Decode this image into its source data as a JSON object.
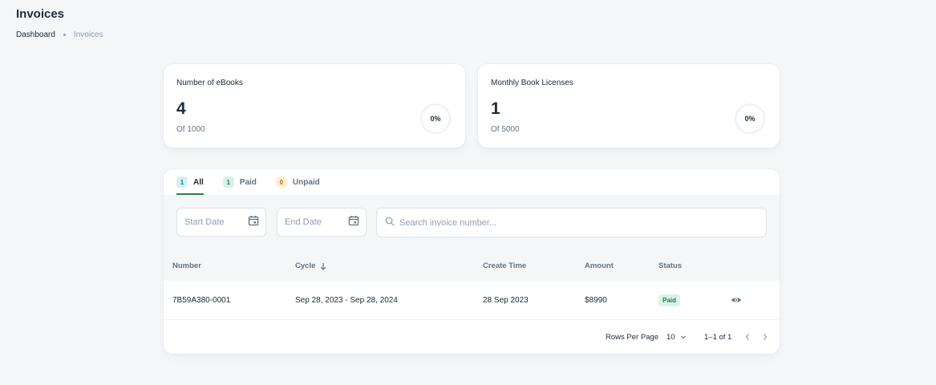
{
  "header": {
    "title": "Invoices",
    "breadcrumb": [
      "Dashboard",
      "Invoices"
    ]
  },
  "stats": [
    {
      "label": "Number of eBooks",
      "value": "4",
      "sub": "Of 1000",
      "percent": "0%"
    },
    {
      "label": "Monthly Book Licenses",
      "value": "1",
      "sub": "Of 5000",
      "percent": "0%"
    }
  ],
  "tabs": [
    {
      "count": "1",
      "label": "All",
      "active": true
    },
    {
      "count": "1",
      "label": "Paid",
      "active": false
    },
    {
      "count": "0",
      "label": "Unpaid",
      "active": false
    }
  ],
  "filters": {
    "start_date_placeholder": "Start Date",
    "end_date_placeholder": "End Date",
    "search_placeholder": "Search invoice number..."
  },
  "table": {
    "columns": [
      "Number",
      "Cycle",
      "Create Time",
      "Amount",
      "Status"
    ],
    "rows": [
      {
        "number": "7B59A380-0001",
        "cycle": "Sep 28, 2023 - Sep 28, 2024",
        "create_time": "28 Sep 2023",
        "amount": "$8990",
        "status": "Paid"
      }
    ]
  },
  "pagination": {
    "rows_per_page_label": "Rows Per Page",
    "rows_per_page": "10",
    "range": "1–1 of 1"
  },
  "colors": {
    "tab_all_badge_bg": "#d6f1f6",
    "tab_all_badge_fg": "#0c7a8c",
    "tab_paid_badge_bg": "#d8f2e6",
    "tab_paid_badge_fg": "#1b7a52",
    "tab_unpaid_badge_bg": "#fdf0d5",
    "tab_unpaid_badge_fg": "#b76e00"
  }
}
